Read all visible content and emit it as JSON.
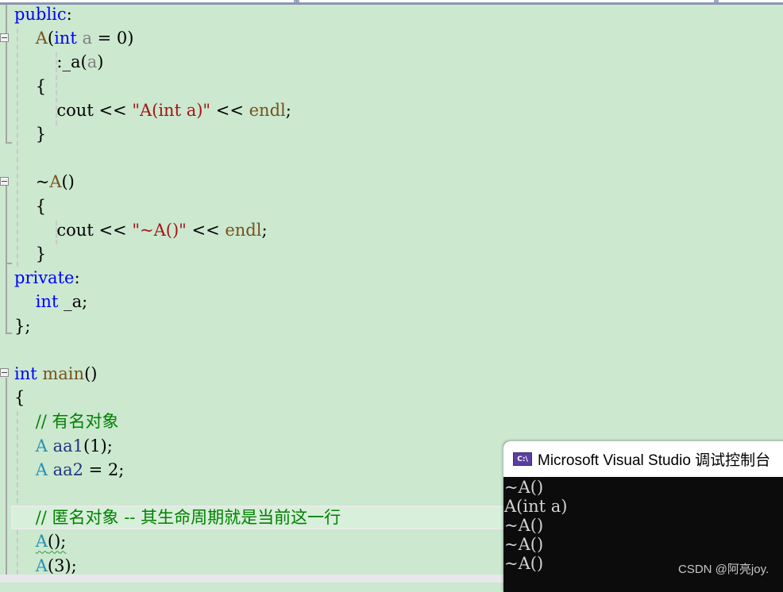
{
  "navbar": {
    "dropdowns": [
      "",
      "",
      ""
    ]
  },
  "code": {
    "lines": [
      {
        "tokens": [
          {
            "t": "public",
            "c": "kw"
          },
          {
            "t": ":",
            "c": "op"
          }
        ]
      },
      {
        "indent": "    ",
        "tokens": [
          {
            "t": "A",
            "c": "fn"
          },
          {
            "t": "(",
            "c": "op"
          },
          {
            "t": "int",
            "c": "kw"
          },
          {
            "t": " ",
            "c": "op"
          },
          {
            "t": "a",
            "c": "param"
          },
          {
            "t": " = 0)",
            "c": "op"
          }
        ]
      },
      {
        "indent": "        ",
        "tokens": [
          {
            "t": ":_a(",
            "c": "op"
          },
          {
            "t": "a",
            "c": "param"
          },
          {
            "t": ")",
            "c": "op"
          }
        ]
      },
      {
        "indent": "    ",
        "tokens": [
          {
            "t": "{",
            "c": "op"
          }
        ]
      },
      {
        "indent": "        ",
        "tokens": [
          {
            "t": "cout",
            "c": "op"
          },
          {
            "t": " << ",
            "c": "op"
          },
          {
            "t": "\"A(int a)\"",
            "c": "str"
          },
          {
            "t": " << ",
            "c": "op"
          },
          {
            "t": "endl",
            "c": "fn"
          },
          {
            "t": ";",
            "c": "op"
          }
        ]
      },
      {
        "indent": "    ",
        "tokens": [
          {
            "t": "}",
            "c": "op"
          }
        ]
      },
      {
        "tokens": []
      },
      {
        "indent": "    ",
        "tokens": [
          {
            "t": "~",
            "c": "op"
          },
          {
            "t": "A",
            "c": "fn"
          },
          {
            "t": "()",
            "c": "op"
          }
        ]
      },
      {
        "indent": "    ",
        "tokens": [
          {
            "t": "{",
            "c": "op"
          }
        ]
      },
      {
        "indent": "        ",
        "tokens": [
          {
            "t": "cout",
            "c": "op"
          },
          {
            "t": " << ",
            "c": "op"
          },
          {
            "t": "\"~A()\"",
            "c": "str"
          },
          {
            "t": " << ",
            "c": "op"
          },
          {
            "t": "endl",
            "c": "fn"
          },
          {
            "t": ";",
            "c": "op"
          }
        ]
      },
      {
        "indent": "    ",
        "tokens": [
          {
            "t": "}",
            "c": "op"
          }
        ]
      },
      {
        "tokens": [
          {
            "t": "private",
            "c": "kw"
          },
          {
            "t": ":",
            "c": "op"
          }
        ]
      },
      {
        "indent": "    ",
        "tokens": [
          {
            "t": "int",
            "c": "kw"
          },
          {
            "t": " _a;",
            "c": "op"
          }
        ]
      },
      {
        "tokens": [
          {
            "t": "};",
            "c": "op"
          }
        ]
      },
      {
        "tokens": []
      },
      {
        "tokens": [
          {
            "t": "int",
            "c": "kw"
          },
          {
            "t": " ",
            "c": "op"
          },
          {
            "t": "main",
            "c": "fn"
          },
          {
            "t": "()",
            "c": "op"
          }
        ]
      },
      {
        "tokens": [
          {
            "t": "{",
            "c": "op"
          }
        ]
      },
      {
        "indent": "    ",
        "tokens": [
          {
            "t": "// 有名对象",
            "c": "cm"
          }
        ]
      },
      {
        "indent": "    ",
        "tokens": [
          {
            "t": "A",
            "c": "ty"
          },
          {
            "t": " ",
            "c": "op"
          },
          {
            "t": "aa1",
            "c": "var"
          },
          {
            "t": "(1);",
            "c": "op"
          }
        ]
      },
      {
        "indent": "    ",
        "tokens": [
          {
            "t": "A",
            "c": "ty"
          },
          {
            "t": " ",
            "c": "op"
          },
          {
            "t": "aa2",
            "c": "var"
          },
          {
            "t": " = 2;",
            "c": "op"
          }
        ]
      },
      {
        "tokens": []
      },
      {
        "indent": "    ",
        "current": true,
        "tokens": [
          {
            "t": "// 匿名对象 -- 其生命周期就是当前这一行",
            "c": "cm"
          }
        ]
      },
      {
        "indent": "    ",
        "tokens": [
          {
            "t": "A",
            "c": "ty squig"
          },
          {
            "t": "();",
            "c": "op squig"
          }
        ]
      },
      {
        "indent": "    ",
        "tokens": [
          {
            "t": "A",
            "c": "ty squig"
          },
          {
            "t": "(3);",
            "c": "op squig"
          }
        ]
      }
    ]
  },
  "console": {
    "title": "Microsoft Visual Studio 调试控制台",
    "icon_label": "C:\\",
    "icon": "console-app-icon",
    "output": [
      "~A()",
      "A(int a)",
      "~A()",
      "~A()",
      "~A()"
    ]
  },
  "watermark": "CSDN @阿亮joy.",
  "colors": {
    "editor_bg": "#cce8cf",
    "keyword": "#0000ff",
    "string": "#a31515",
    "comment": "#008000",
    "type": "#2b91af",
    "function": "#74531f",
    "console_bg": "#0c0c0c"
  }
}
